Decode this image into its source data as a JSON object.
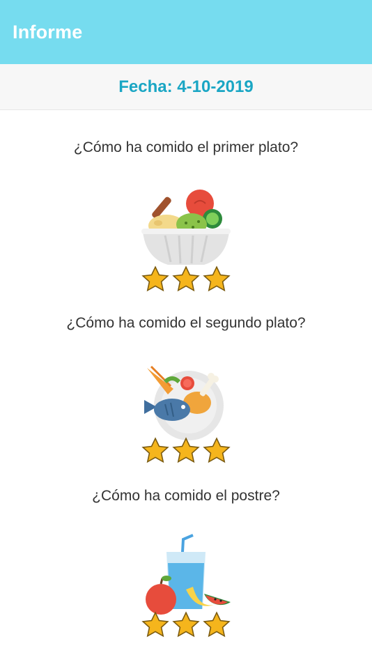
{
  "header": {
    "title": "Informe"
  },
  "date": {
    "label": "Fecha: 4-10-2019"
  },
  "sections": [
    {
      "question": "¿Cómo ha comido el primer plato?",
      "icon": "salad-bowl-icon",
      "rating": 3,
      "max_rating": 3
    },
    {
      "question": "¿Cómo ha comido el segundo plato?",
      "icon": "main-course-plate-icon",
      "rating": 3,
      "max_rating": 3
    },
    {
      "question": "¿Cómo ha comido el postre?",
      "icon": "dessert-fruit-drink-icon",
      "rating": 3,
      "max_rating": 3
    }
  ],
  "colors": {
    "appbar": "#76dcef",
    "date_text": "#1aa6c4",
    "star_fill": "#f5b51c",
    "star_stroke": "#7a5a10"
  }
}
